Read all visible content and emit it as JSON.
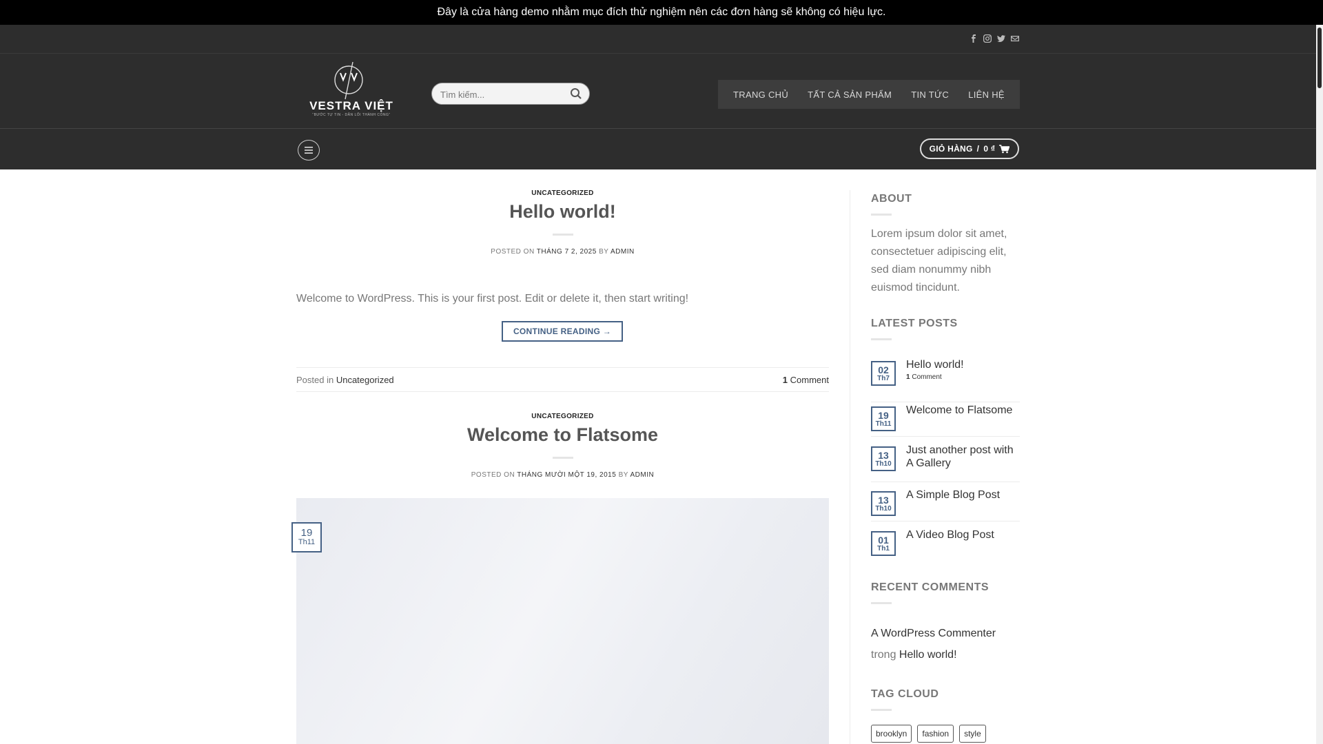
{
  "notice": {
    "text": "Đây là cửa hàng demo nhằm mục đích thử nghiệm nên các đơn hàng sẽ không có hiệu lực."
  },
  "social": [
    "facebook-icon",
    "instagram-icon",
    "twitter-icon",
    "email-icon"
  ],
  "logo": {
    "name": "VESTRA VIỆT",
    "tagline": "“BƯỚC TỰ TIN - DẪN LỐI THÀNH CÔNG”"
  },
  "search": {
    "placeholder": "Tìm kiếm..."
  },
  "nav": {
    "items": [
      "TRANG CHỦ",
      "TẤT CẢ SẢN PHẨM",
      "TIN TỨC",
      "LIÊN HỆ"
    ]
  },
  "cart": {
    "label": "GIỎ HÀNG",
    "sep": "/",
    "total": "0 ₫"
  },
  "posts": [
    {
      "category": "UNCATEGORIZED",
      "title": "Hello world!",
      "posted_on_label": "POSTED ON",
      "date": "THÁNG 7 2, 2025",
      "by_label": "BY",
      "author": "ADMIN",
      "excerpt": "Welcome to WordPress. This is your first post. Edit or delete it, then start writing!",
      "continue_label": "CONTINUE READING →",
      "posted_in_label": "Posted in",
      "posted_in_cat": "Uncategorized",
      "comments_count": "1",
      "comments_label": "Comment"
    },
    {
      "category": "UNCATEGORIZED",
      "title": "Welcome to Flatsome",
      "posted_on_label": "POSTED ON",
      "date": "THÁNG MƯỜI MỘT 19, 2015",
      "by_label": "BY",
      "author": "ADMIN",
      "date_badge": {
        "day": "19",
        "month": "Th11"
      }
    }
  ],
  "sidebar": {
    "about": {
      "title": "ABOUT",
      "text": "Lorem ipsum dolor sit amet, consectetuer adipiscing elit, sed diam nonummy nibh euismod tincidunt."
    },
    "latest_posts": {
      "title": "LATEST POSTS",
      "items": [
        {
          "day": "02",
          "month": "Th7",
          "title": "Hello world!",
          "comment_count": "1",
          "comment_label": "Comment"
        },
        {
          "day": "19",
          "month": "Th11",
          "title": "Welcome to Flatsome"
        },
        {
          "day": "13",
          "month": "Th10",
          "title": "Just another post with A Gallery"
        },
        {
          "day": "13",
          "month": "Th10",
          "title": "A Simple Blog Post"
        },
        {
          "day": "01",
          "month": "Th1",
          "title": "A Video Blog Post"
        }
      ]
    },
    "recent_comments": {
      "title": "RECENT COMMENTS",
      "author": "A WordPress Commenter",
      "on_label": "trong",
      "post": "Hello world!"
    },
    "tag_cloud": {
      "title": "TAG CLOUD",
      "tags": [
        "brooklyn",
        "fashion",
        "style"
      ]
    }
  },
  "colors": {
    "accent": "#446084",
    "header_bg": "#2d2d2d",
    "notice_bg": "#000000"
  }
}
